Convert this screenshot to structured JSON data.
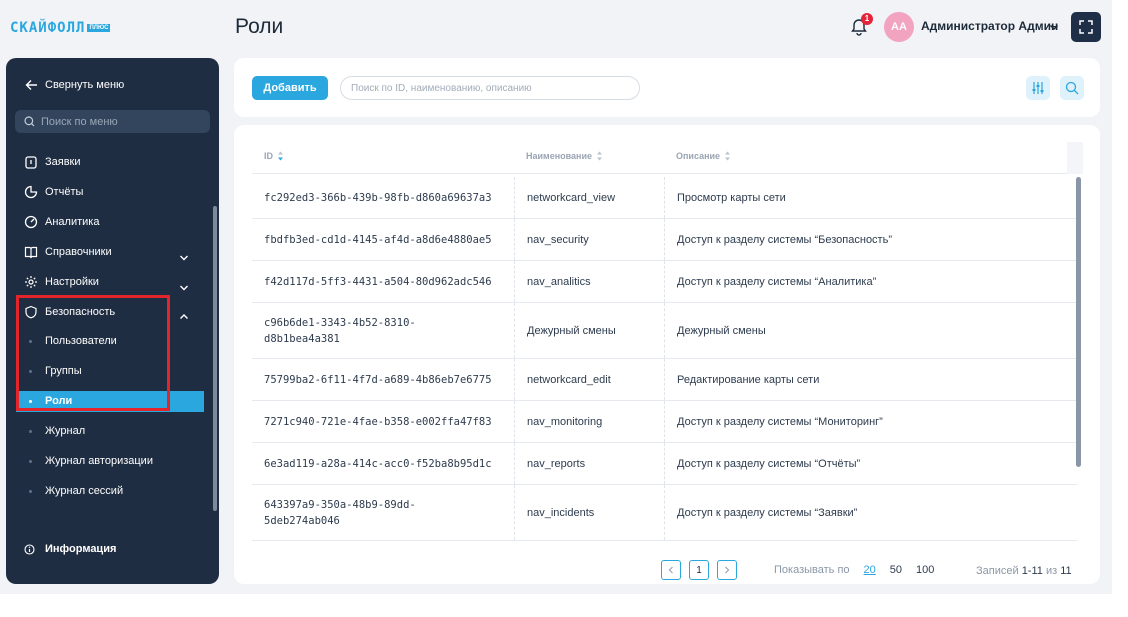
{
  "logo": {
    "text": "СКАЙФОЛЛ",
    "tag": "ПЛЮС"
  },
  "header": {
    "title": "Роли",
    "notifications_count": "1",
    "avatar_initials": "АА",
    "user_name": "Администратор Админ"
  },
  "sidebar": {
    "collapse_label": "Свернуть меню",
    "search_placeholder": "Поиск по меню",
    "items": [
      {
        "label": "Заявки",
        "icon": "clipboard-icon"
      },
      {
        "label": "Отчёты",
        "icon": "pie-chart-icon"
      },
      {
        "label": "Аналитика",
        "icon": "analytics-icon"
      },
      {
        "label": "Справочники",
        "icon": "book-icon"
      },
      {
        "label": "Настройки",
        "icon": "gear-icon"
      },
      {
        "label": "Безопасность",
        "icon": "shield-icon"
      }
    ],
    "security_sub": [
      {
        "label": "Пользователи"
      },
      {
        "label": "Группы"
      },
      {
        "label": "Роли"
      },
      {
        "label": "Журнал"
      },
      {
        "label": "Журнал авторизации"
      },
      {
        "label": "Журнал сессий"
      }
    ],
    "info_label": "Информация"
  },
  "toolbar": {
    "add_label": "Добавить",
    "search_placeholder": "Поиск по ID, наименованию, описанию"
  },
  "table": {
    "columns": [
      "ID",
      "Наименование",
      "Описание"
    ],
    "rows": [
      {
        "id": "fc292ed3-366b-439b-98fb-d860a69637a3",
        "name": "networkcard_view",
        "desc": "Просмотр карты сети"
      },
      {
        "id": "fbdfb3ed-cd1d-4145-af4d-a8d6e4880ae5",
        "name": "nav_security",
        "desc": "Доступ к разделу системы “Безопасность”"
      },
      {
        "id": "f42d117d-5ff3-4431-a504-80d962adc546",
        "name": "nav_analitics",
        "desc": "Доступ к разделу системы “Аналитика”"
      },
      {
        "id": "c96b6de1-3343-4b52-8310-d8b1bea4a381",
        "name": "Дежурный смены",
        "desc": "Дежурный смены"
      },
      {
        "id": "75799ba2-6f11-4f7d-a689-4b86eb7e6775",
        "name": "networkcard_edit",
        "desc": "Редактирование карты сети"
      },
      {
        "id": "7271c940-721e-4fae-b358-e002ffa47f83",
        "name": "nav_monitoring",
        "desc": "Доступ к разделу системы “Мониторинг”"
      },
      {
        "id": "6e3ad119-a28a-414c-acc0-f52ba8b95d1c",
        "name": "nav_reports",
        "desc": "Доступ к разделу системы “Отчёты”"
      },
      {
        "id": "643397a9-350a-48b9-89dd-5deb274ab046",
        "name": "nav_incidents",
        "desc": "Доступ к разделу системы “Заявки”"
      }
    ]
  },
  "pagination": {
    "current_page": "1",
    "per_page_label": "Показывать по",
    "per_page_options": [
      "20",
      "50",
      "100"
    ],
    "records_label": "Записей",
    "records_range": "1-11",
    "records_of": "из",
    "records_total": "11"
  },
  "colors": {
    "accent": "#2aa7df",
    "sidebar": "#1f2d42",
    "highlight": "#e3242b",
    "badge": "#e3243b"
  }
}
